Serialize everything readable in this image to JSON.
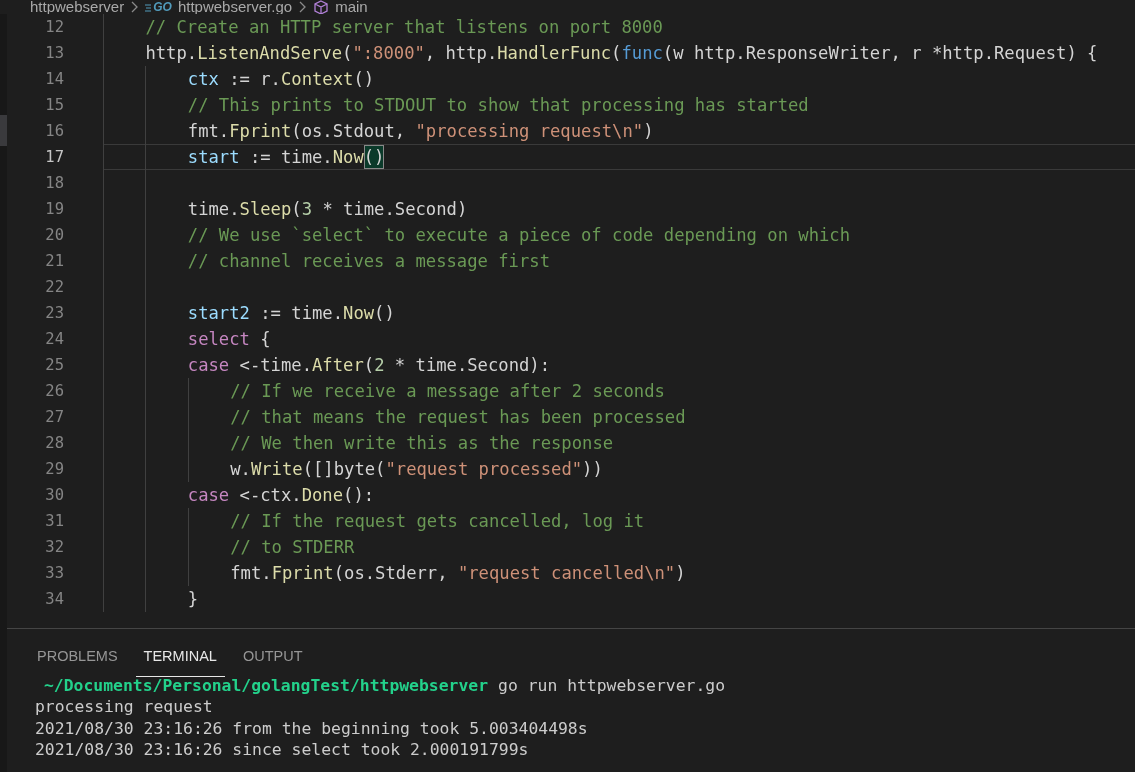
{
  "breadcrumb": [
    {
      "kind": "folder",
      "label": "httpwebserver"
    },
    {
      "kind": "go-file",
      "label": "httpwebserver.go",
      "icon_text": "GO"
    },
    {
      "kind": "symbol",
      "label": "main"
    }
  ],
  "editor": {
    "lines": [
      {
        "number": "12",
        "current": false,
        "tokens": [
          {
            "kind": "comment",
            "text": "    // Create an HTTP server that listens on port 8000"
          }
        ]
      },
      {
        "number": "13",
        "current": false,
        "tokens": [
          {
            "kind": "plain",
            "text": "    http."
          },
          {
            "kind": "function",
            "text": "ListenAndServe"
          },
          {
            "kind": "plain",
            "text": "("
          },
          {
            "kind": "string",
            "text": "\":8000\""
          },
          {
            "kind": "plain",
            "text": ", http."
          },
          {
            "kind": "function",
            "text": "HandlerFunc"
          },
          {
            "kind": "plain",
            "text": "("
          },
          {
            "kind": "storage",
            "text": "func"
          },
          {
            "kind": "plain",
            "text": "(w http.ResponseWriter, r *http.Request) {"
          }
        ]
      },
      {
        "number": "14",
        "current": false,
        "tokens": [
          {
            "kind": "variable",
            "text": "        ctx"
          },
          {
            "kind": "plain",
            "text": " := r."
          },
          {
            "kind": "function",
            "text": "Context"
          },
          {
            "kind": "plain",
            "text": "()"
          }
        ]
      },
      {
        "number": "15",
        "current": false,
        "tokens": [
          {
            "kind": "comment",
            "text": "        // This prints to STDOUT to show that processing has started"
          }
        ]
      },
      {
        "number": "16",
        "current": false,
        "tokens": [
          {
            "kind": "plain",
            "text": "        fmt."
          },
          {
            "kind": "function",
            "text": "Fprint"
          },
          {
            "kind": "plain",
            "text": "(os.Stdout, "
          },
          {
            "kind": "string",
            "text": "\"processing request\\n\""
          },
          {
            "kind": "plain",
            "text": ")"
          }
        ]
      },
      {
        "number": "17",
        "current": true,
        "tokens": [
          {
            "kind": "variable",
            "text": "        start"
          },
          {
            "kind": "plain",
            "text": " := time."
          },
          {
            "kind": "function",
            "text": "Now"
          },
          {
            "kind": "bracket-match",
            "text": "()"
          }
        ]
      },
      {
        "number": "18",
        "current": false
      },
      {
        "number": "19",
        "current": false,
        "tokens": [
          {
            "kind": "plain",
            "text": "        time."
          },
          {
            "kind": "function",
            "text": "Sleep"
          },
          {
            "kind": "plain",
            "text": "("
          },
          {
            "kind": "number",
            "text": "3"
          },
          {
            "kind": "plain",
            "text": " * time.Second)"
          }
        ]
      },
      {
        "number": "20",
        "current": false,
        "tokens": [
          {
            "kind": "comment",
            "text": "        // We use `select` to execute a piece of code depending on which"
          }
        ]
      },
      {
        "number": "21",
        "current": false,
        "tokens": [
          {
            "kind": "comment",
            "text": "        // channel receives a message first"
          }
        ]
      },
      {
        "number": "22",
        "current": false
      },
      {
        "number": "23",
        "current": false,
        "tokens": [
          {
            "kind": "variable",
            "text": "        start2"
          },
          {
            "kind": "plain",
            "text": " := time."
          },
          {
            "kind": "function",
            "text": "Now"
          },
          {
            "kind": "plain",
            "text": "()"
          }
        ]
      },
      {
        "number": "24",
        "current": false,
        "tokens": [
          {
            "kind": "keyword",
            "text": "        select"
          },
          {
            "kind": "plain",
            "text": " {"
          }
        ]
      },
      {
        "number": "25",
        "current": false,
        "tokens": [
          {
            "kind": "keyword",
            "text": "        case"
          },
          {
            "kind": "plain",
            "text": " <-time."
          },
          {
            "kind": "function",
            "text": "After"
          },
          {
            "kind": "plain",
            "text": "("
          },
          {
            "kind": "number",
            "text": "2"
          },
          {
            "kind": "plain",
            "text": " * time.Second):"
          }
        ]
      },
      {
        "number": "26",
        "current": false,
        "tokens": [
          {
            "kind": "comment",
            "text": "            // If we receive a message after 2 seconds"
          }
        ]
      },
      {
        "number": "27",
        "current": false,
        "tokens": [
          {
            "kind": "comment",
            "text": "            // that means the request has been processed"
          }
        ]
      },
      {
        "number": "28",
        "current": false,
        "tokens": [
          {
            "kind": "comment",
            "text": "            // We then write this as the response"
          }
        ]
      },
      {
        "number": "29",
        "current": false,
        "tokens": [
          {
            "kind": "plain",
            "text": "            w."
          },
          {
            "kind": "function",
            "text": "Write"
          },
          {
            "kind": "plain",
            "text": "([]byte("
          },
          {
            "kind": "string",
            "text": "\"request processed\""
          },
          {
            "kind": "plain",
            "text": "))"
          }
        ]
      },
      {
        "number": "30",
        "current": false,
        "tokens": [
          {
            "kind": "keyword",
            "text": "        case"
          },
          {
            "kind": "plain",
            "text": " <-ctx."
          },
          {
            "kind": "function",
            "text": "Done"
          },
          {
            "kind": "plain",
            "text": "():"
          }
        ]
      },
      {
        "number": "31",
        "current": false,
        "tokens": [
          {
            "kind": "comment",
            "text": "            // If the request gets cancelled, log it"
          }
        ]
      },
      {
        "number": "32",
        "current": false,
        "tokens": [
          {
            "kind": "comment",
            "text": "            // to STDERR"
          }
        ]
      },
      {
        "number": "33",
        "current": false,
        "tokens": [
          {
            "kind": "plain",
            "text": "            fmt."
          },
          {
            "kind": "function",
            "text": "Fprint"
          },
          {
            "kind": "plain",
            "text": "(os.Stderr, "
          },
          {
            "kind": "string",
            "text": "\"request cancelled\\n\""
          },
          {
            "kind": "plain",
            "text": ")"
          }
        ]
      },
      {
        "number": "34",
        "current": false,
        "tokens": [
          {
            "kind": "plain",
            "text": "        }"
          }
        ]
      }
    ]
  },
  "panel": {
    "tabs": [
      {
        "label": "PROBLEMS",
        "selected": false
      },
      {
        "label": "TERMINAL",
        "selected": true
      },
      {
        "label": "OUTPUT",
        "selected": false
      }
    ],
    "terminal": [
      {
        "kind": "prompt",
        "path": "~/Documents/Personal/golangTest/httpwebserver",
        "command": "go run httpwebserver.go"
      },
      {
        "kind": "output",
        "text": "processing request"
      },
      {
        "kind": "output",
        "text": "2021/08/30 23:16:26 from the beginning took 5.003404498s"
      },
      {
        "kind": "output",
        "text": "2021/08/30 23:16:26 since select took 2.000191799s"
      }
    ]
  }
}
